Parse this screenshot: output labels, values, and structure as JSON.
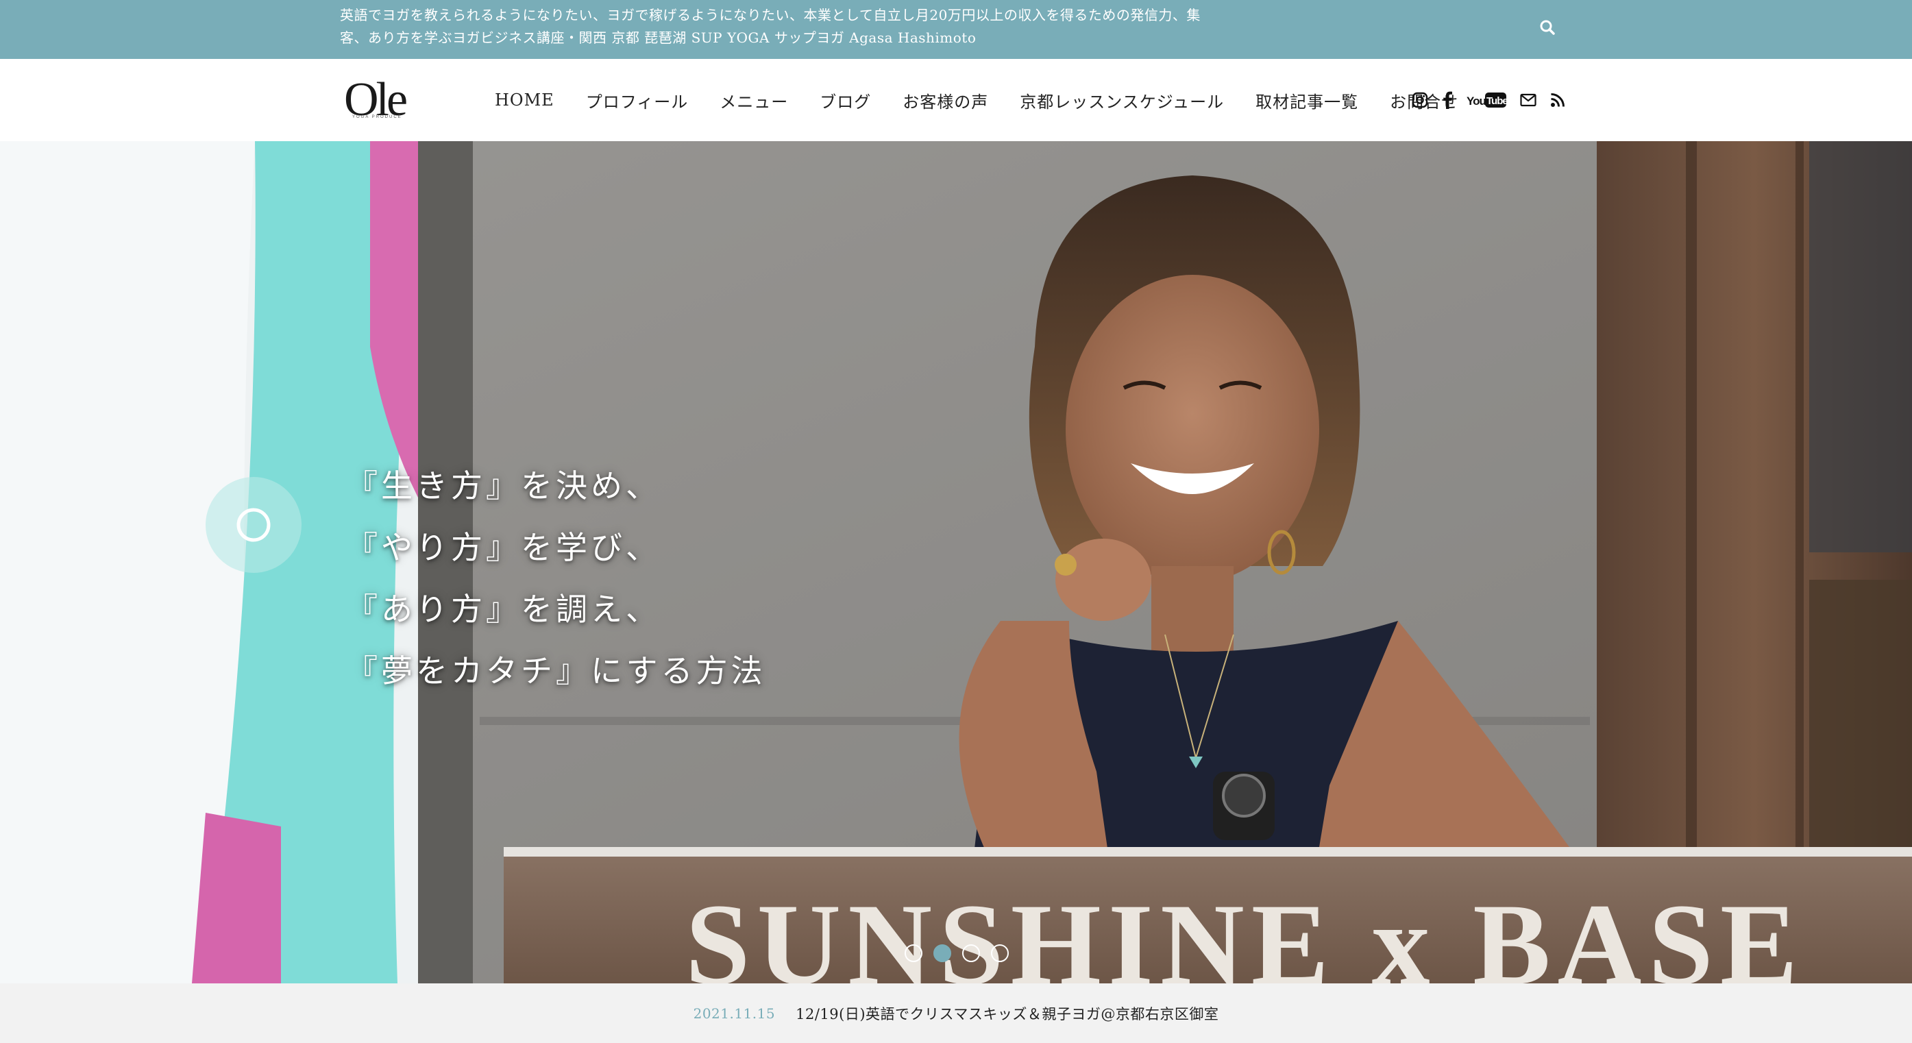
{
  "topbar": {
    "tagline_line1": "英語でヨガを教えられるようになりたい、ヨガで稼げるようになりたい、本業として自立し月20万円以上の収入を得るための発信力、集",
    "tagline_line2": "客、あり方を学ぶヨガビジネス講座・関西 京都 琵琶湖 SUP YOGA サップヨガ Agasa Hashimoto",
    "search_icon": "search-icon"
  },
  "header": {
    "logo_text": "Ole",
    "logo_subtext": "YOGA PRODUCE",
    "nav": [
      {
        "label": "HOME"
      },
      {
        "label": "プロフィール"
      },
      {
        "label": "メニュー"
      },
      {
        "label": "ブログ"
      },
      {
        "label": "お客様の声"
      },
      {
        "label": "京都レッスンスケジュール"
      },
      {
        "label": "取材記事一覧"
      },
      {
        "label": "お問合せ"
      }
    ],
    "social_icons": [
      "instagram-icon",
      "facebook-icon",
      "youtube-icon",
      "mail-icon",
      "rss-icon"
    ],
    "youtube_text_you": "You",
    "youtube_text_tube": "Tube"
  },
  "hero": {
    "lines": [
      "『生き方』を決め、",
      "『やり方』を学び、",
      "『あり方』を調え、",
      "『夢をカタチ』にする方法"
    ],
    "sign_text": "SUNSHINE x BASE",
    "slide_count": 4,
    "active_slide": 2
  },
  "news": {
    "date": "2021.11.15",
    "title": "12/19(日)英語でクリスマスキッズ＆親子ヨガ@京都右京区御室"
  },
  "colors": {
    "accent": "#79adb8",
    "text": "#222222",
    "news_bg": "#f2f2f2"
  }
}
